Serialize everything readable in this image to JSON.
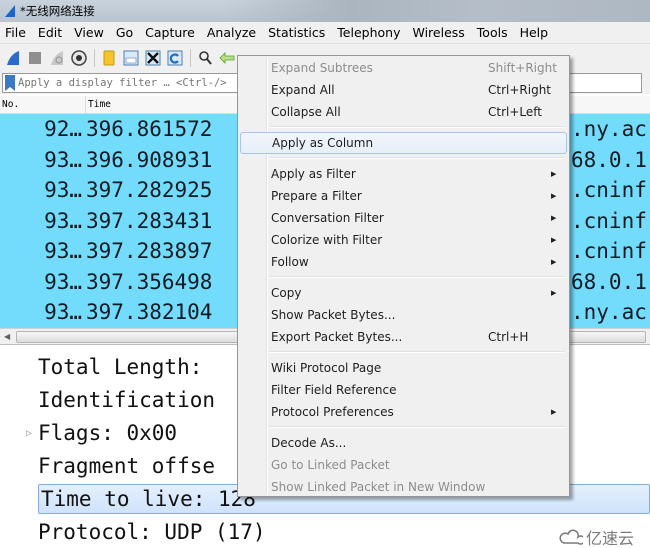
{
  "window": {
    "title": "*无线网络连接"
  },
  "menubar": {
    "items": [
      "File",
      "Edit",
      "View",
      "Go",
      "Capture",
      "Analyze",
      "Statistics",
      "Telephony",
      "Wireless",
      "Tools",
      "Help"
    ]
  },
  "toolbar": {
    "icons": [
      "start-capture-icon",
      "stop-capture-icon",
      "restart-capture-icon",
      "capture-options-icon",
      "open-file-icon",
      "save-file-icon",
      "close-file-icon",
      "reload-file-icon",
      "find-packet-icon",
      "go-back-icon"
    ]
  },
  "filter": {
    "placeholder": "Apply a display filter … <Ctrl-/>",
    "value": ""
  },
  "packet_list": {
    "columns": [
      "No.",
      "Time"
    ],
    "rows": [
      {
        "no": "92…",
        "time": "396.861572",
        "tail": ".ny.ac"
      },
      {
        "no": "93…",
        "time": "396.908931",
        "tail": "68.0.1"
      },
      {
        "no": "93…",
        "time": "397.282925",
        "tail": ".cninf"
      },
      {
        "no": "93…",
        "time": "397.283431",
        "tail": ".cninf"
      },
      {
        "no": "93…",
        "time": "397.283897",
        "tail": ".cninf"
      },
      {
        "no": "93…",
        "time": "397.356498",
        "tail": "68.0.1"
      },
      {
        "no": "93…",
        "time": "397.382104",
        "tail": ".ny.ac"
      }
    ],
    "row_color": "#73dcfc"
  },
  "detail_pane": {
    "rows": [
      {
        "text": "Total Length:",
        "expandable": false,
        "selected": false
      },
      {
        "text": "Identification",
        "expandable": false,
        "selected": false
      },
      {
        "text": "Flags: 0x00",
        "expandable": true,
        "selected": false
      },
      {
        "text": "Fragment offse",
        "expandable": false,
        "selected": false
      },
      {
        "text": "Time to live: 128",
        "expandable": false,
        "selected": true
      },
      {
        "text": "Protocol: UDP (17)",
        "expandable": false,
        "selected": false
      }
    ]
  },
  "context_menu": {
    "items": [
      {
        "label": "Expand Subtrees",
        "shortcut": "Shift+Right",
        "disabled": true,
        "submenu": false
      },
      {
        "label": "Expand All",
        "shortcut": "Ctrl+Right",
        "disabled": false,
        "submenu": false
      },
      {
        "label": "Collapse All",
        "shortcut": "Ctrl+Left",
        "disabled": false,
        "submenu": false
      },
      {
        "separator": true
      },
      {
        "label": "Apply as Column",
        "shortcut": "",
        "disabled": false,
        "submenu": false,
        "highlighted": true
      },
      {
        "separator": true
      },
      {
        "label": "Apply as Filter",
        "shortcut": "",
        "disabled": false,
        "submenu": true
      },
      {
        "label": "Prepare a Filter",
        "shortcut": "",
        "disabled": false,
        "submenu": true
      },
      {
        "label": "Conversation Filter",
        "shortcut": "",
        "disabled": false,
        "submenu": true
      },
      {
        "label": "Colorize with Filter",
        "shortcut": "",
        "disabled": false,
        "submenu": true
      },
      {
        "label": "Follow",
        "shortcut": "",
        "disabled": false,
        "submenu": true
      },
      {
        "separator": true
      },
      {
        "label": "Copy",
        "shortcut": "",
        "disabled": false,
        "submenu": true
      },
      {
        "label": "Show Packet Bytes...",
        "shortcut": "",
        "disabled": false,
        "submenu": false
      },
      {
        "label": "Export Packet Bytes...",
        "shortcut": "Ctrl+H",
        "disabled": false,
        "submenu": false
      },
      {
        "separator": true
      },
      {
        "label": "Wiki Protocol Page",
        "shortcut": "",
        "disabled": false,
        "submenu": false
      },
      {
        "label": "Filter Field Reference",
        "shortcut": "",
        "disabled": false,
        "submenu": false
      },
      {
        "label": "Protocol Preferences",
        "shortcut": "",
        "disabled": false,
        "submenu": true
      },
      {
        "separator": true
      },
      {
        "label": "Decode As...",
        "shortcut": "",
        "disabled": false,
        "submenu": false
      },
      {
        "label": "Go to Linked Packet",
        "shortcut": "",
        "disabled": true,
        "submenu": false
      },
      {
        "label": "Show Linked Packet in New Window",
        "shortcut": "",
        "disabled": true,
        "submenu": false
      }
    ]
  },
  "watermark": {
    "text": "亿速云"
  }
}
